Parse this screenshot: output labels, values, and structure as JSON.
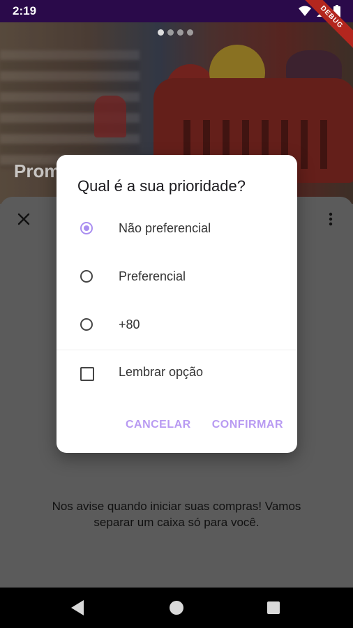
{
  "status_bar": {
    "time": "2:19",
    "icons": [
      "wifi-icon",
      "signal-icon",
      "battery-icon"
    ],
    "debug_label": "DEBUG"
  },
  "hero": {
    "title": "Prom",
    "carousel_dots": 4,
    "active_dot": 0
  },
  "sheet": {
    "message_line1": "Nos avise quando iniciar suas compras! Vamos",
    "message_line2": "separar um caixa só para você."
  },
  "dialog": {
    "title": "Qual é a sua prioridade?",
    "options": [
      {
        "label": "Não preferencial",
        "selected": true
      },
      {
        "label": "Preferencial",
        "selected": false
      },
      {
        "label": "+80",
        "selected": false
      }
    ],
    "remember_label": "Lembrar opção",
    "remember_checked": false,
    "cancel_label": "CANCELAR",
    "confirm_label": "CONFIRMAR"
  },
  "colors": {
    "accent": "#a98ef0",
    "status_bar": "#2a0a4a",
    "button_text": "#b89af2"
  }
}
